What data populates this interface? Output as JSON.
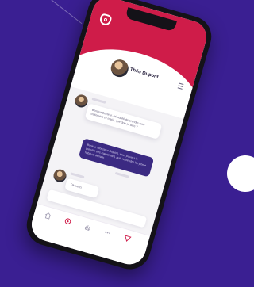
{
  "colors": {
    "background": "#3a1f92",
    "accent": "#cf1c49",
    "outgoing_bubble": "#3b2a82"
  },
  "header": {
    "profile_name": "Théo Dupont",
    "logo_icon": "app-logo-icon",
    "menu_icon": "menu-icon"
  },
  "messages": [
    {
      "from": "contact",
      "text": "Bonjour Docteur, j'ai oublié de prendre mon traitement ce matin, que dois-je faire ?"
    },
    {
      "from": "me",
      "text": "Bonjour Monsieur Dupont, vous pouvez le prendre dès maintenant, puis reprendre le rythme habituel demain."
    },
    {
      "from": "contact",
      "text": "Ok merci"
    }
  ],
  "input": {
    "placeholder": ""
  },
  "tabs": [
    {
      "label": "",
      "icon": "home-icon"
    },
    {
      "label": "",
      "icon": "chat-icon",
      "active": true
    },
    {
      "label": "",
      "icon": "hand-icon"
    },
    {
      "label": "",
      "icon": "more-icon"
    },
    {
      "label": "",
      "icon": "send-icon"
    }
  ]
}
